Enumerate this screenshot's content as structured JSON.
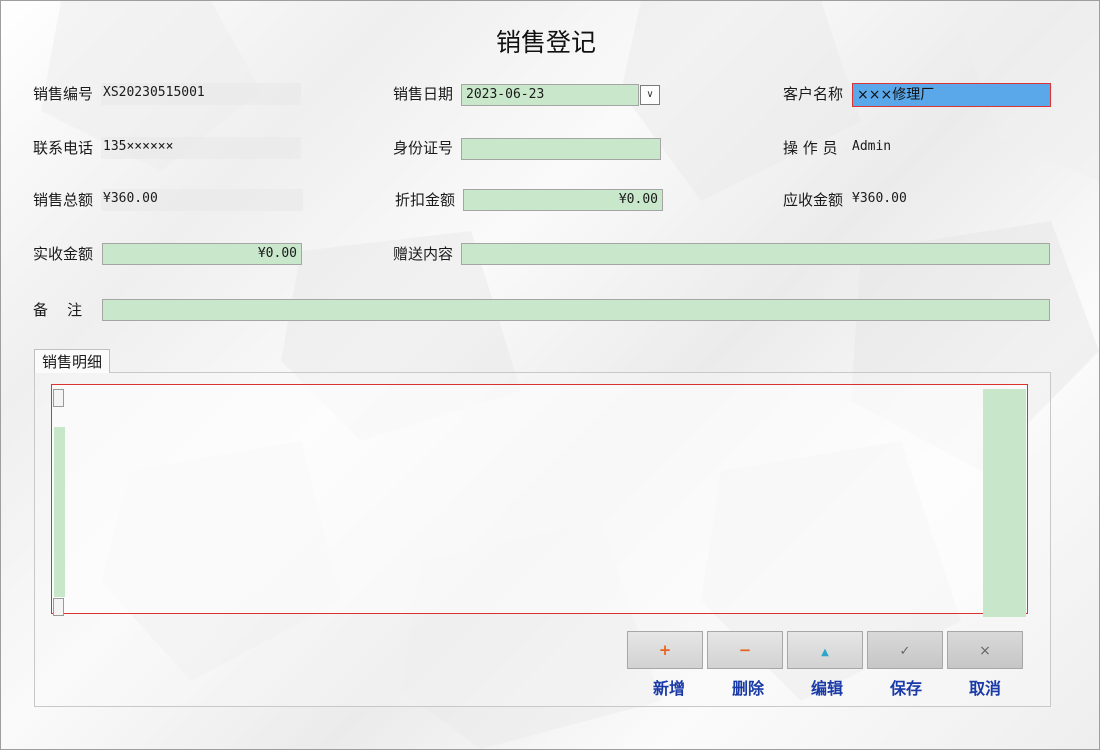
{
  "window": {
    "title": "销售登记"
  },
  "form": {
    "sale_no": {
      "label": "销售编号",
      "value": "XS20230515001"
    },
    "sale_date": {
      "label": "销售日期",
      "value": "2023-06-23"
    },
    "customer": {
      "label": "客户名称",
      "value": "×××修理厂"
    },
    "phone": {
      "label": "联系电话",
      "value": "135××××××"
    },
    "id_no": {
      "label": "身份证号",
      "value": ""
    },
    "operator": {
      "label": "操 作 员",
      "value": "Admin"
    },
    "total": {
      "label": "销售总额",
      "value": "¥360.00"
    },
    "discount": {
      "label": "折扣金额",
      "value": "¥0.00"
    },
    "receivable": {
      "label": "应收金额",
      "value": "¥360.00"
    },
    "received": {
      "label": "实收金额",
      "value": "¥0.00"
    },
    "gift": {
      "label": "赠送内容",
      "value": ""
    },
    "remark": {
      "label": "备    注",
      "value": ""
    }
  },
  "detail_tab": {
    "label": "销售明细"
  },
  "toolbar": {
    "buttons": [
      {
        "label": "新增",
        "icon": "plus-icon",
        "glyph": "+",
        "color": "#e8641e"
      },
      {
        "label": "删除",
        "icon": "minus-icon",
        "glyph": "−",
        "color": "#e8641e"
      },
      {
        "label": "编辑",
        "icon": "triangle-up-icon",
        "glyph": "▲",
        "color": "#2aa6c8"
      },
      {
        "label": "保存",
        "icon": "check-icon",
        "glyph": "✓",
        "color": "#666666"
      },
      {
        "label": "取消",
        "icon": "close-icon",
        "glyph": "×",
        "color": "#666666"
      }
    ]
  },
  "colors": {
    "input_bg": "#c9e8cb",
    "selected_bg": "#5aa8ea",
    "focus_border": "#d9322f",
    "button_label": "#1a3aa8"
  }
}
